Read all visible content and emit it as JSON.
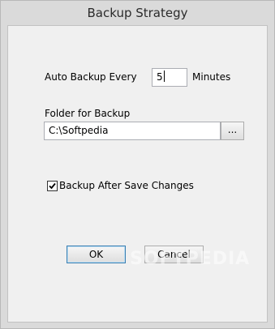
{
  "window": {
    "title": "Backup Strategy"
  },
  "auto_backup": {
    "label": "Auto Backup Every",
    "value": "5",
    "unit": "Minutes"
  },
  "folder": {
    "label": "Folder for Backup",
    "value": "C:\\Softpedia",
    "browse_label": "..."
  },
  "checkbox": {
    "label": "Backup After Save Changes",
    "checked": true
  },
  "buttons": {
    "ok": "OK",
    "cancel": "Cancel"
  },
  "watermark": "SOFTPEDIA"
}
